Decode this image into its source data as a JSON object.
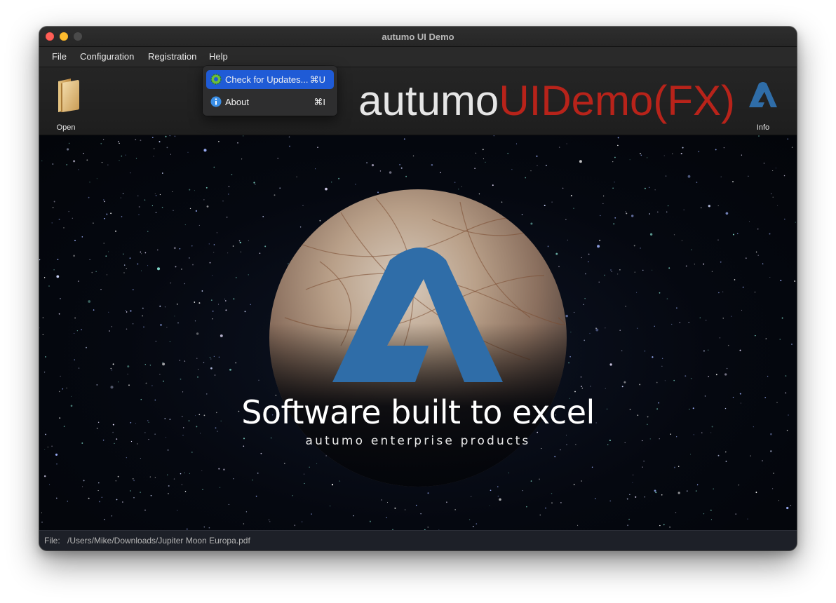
{
  "window": {
    "title": "autumo UI Demo"
  },
  "menubar": {
    "items": [
      "File",
      "Configuration",
      "Registration",
      "Help"
    ]
  },
  "help_menu": {
    "items": [
      {
        "label": "Check for Updates...",
        "shortcut": "⌘U",
        "icon": "gear-update-icon",
        "highlighted": true
      },
      {
        "label": "About",
        "shortcut": "⌘I",
        "icon": "info-icon",
        "highlighted": false
      }
    ]
  },
  "toolbar": {
    "open_label": "Open",
    "info_label": "Info",
    "brand_light": "autumo",
    "brand_accent": "UIDemo(FX)"
  },
  "hero": {
    "headline": "Software built to excel",
    "subline": "autumo enterprise products"
  },
  "statusbar": {
    "label": "File:",
    "value": "/Users/Mike/Downloads/Jupiter Moon Europa.pdf"
  },
  "colors": {
    "brand_accent": "#b8231a",
    "logo_blue": "#2f6da8",
    "menu_highlight": "#1f5bd6"
  }
}
